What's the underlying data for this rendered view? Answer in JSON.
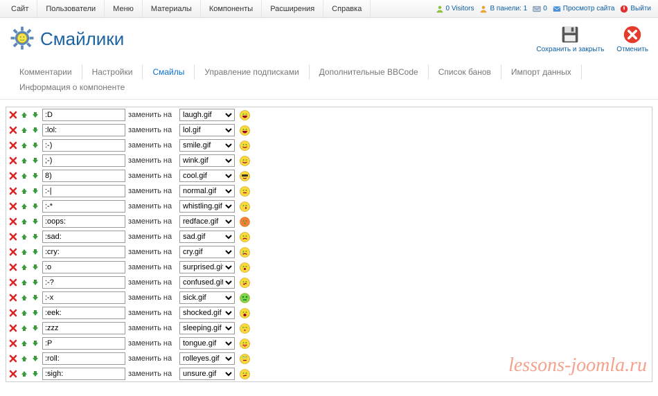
{
  "top_menu": {
    "items": [
      "Сайт",
      "Пользователи",
      "Меню",
      "Материалы",
      "Компоненты",
      "Расширения",
      "Справка"
    ]
  },
  "status_bar": {
    "visitors": {
      "label": "0 Visitors",
      "count": 0
    },
    "panel": {
      "label": "В панели: 1",
      "count": 1
    },
    "messages": {
      "label": "0",
      "count": 0
    },
    "preview": {
      "label": "Просмотр сайта"
    },
    "logout": {
      "label": "Выйти"
    }
  },
  "header": {
    "title": "Смайлики"
  },
  "toolbar": {
    "save_close": "Сохранить и закрыть",
    "cancel": "Отменить"
  },
  "tabs": {
    "items": [
      "Комментарии",
      "Настройки",
      "Смайлы",
      "Управление подписками",
      "Дополнительные BBCode",
      "Список банов",
      "Импорт данных",
      "Информация о компоненте"
    ],
    "active_index": 2
  },
  "rows_label": {
    "replace_with": "заменить на"
  },
  "smilies": [
    {
      "code": ":D",
      "file": "laugh.gif",
      "face": {
        "body": "#FFD93B",
        "mouth": "laugh"
      }
    },
    {
      "code": ":lol:",
      "file": "lol.gif",
      "face": {
        "body": "#FFD93B",
        "mouth": "laugh"
      }
    },
    {
      "code": ":-)",
      "file": "smile.gif",
      "face": {
        "body": "#FFD93B",
        "mouth": "smile"
      }
    },
    {
      "code": ";-)",
      "file": "wink.gif",
      "face": {
        "body": "#FFD93B",
        "mouth": "wink"
      }
    },
    {
      "code": "8)",
      "file": "cool.gif",
      "face": {
        "body": "#FFD93B",
        "mouth": "cool"
      }
    },
    {
      "code": ":-|",
      "file": "normal.gif",
      "face": {
        "body": "#FFD93B",
        "mouth": "flat"
      }
    },
    {
      "code": ":-*",
      "file": "whistling.gif",
      "face": {
        "body": "#FFD93B",
        "mouth": "whistle"
      }
    },
    {
      "code": ":oops:",
      "file": "redface.gif",
      "face": {
        "body": "#F97B3E",
        "mouth": "oops"
      }
    },
    {
      "code": ":sad:",
      "file": "sad.gif",
      "face": {
        "body": "#FFD93B",
        "mouth": "sad"
      }
    },
    {
      "code": ":cry:",
      "file": "cry.gif",
      "face": {
        "body": "#FFD93B",
        "mouth": "cry"
      }
    },
    {
      "code": ":o",
      "file": "surprised.gif",
      "face": {
        "body": "#FFD93B",
        "mouth": "o"
      }
    },
    {
      "code": ":-?",
      "file": "confused.gif",
      "face": {
        "body": "#FFD93B",
        "mouth": "confused"
      }
    },
    {
      "code": ":-x",
      "file": "sick.gif",
      "face": {
        "body": "#7BD84B",
        "mouth": "sick"
      }
    },
    {
      "code": ":eek:",
      "file": "shocked.gif",
      "face": {
        "body": "#FFD93B",
        "mouth": "eek"
      }
    },
    {
      "code": ":zzz",
      "file": "sleeping.gif",
      "face": {
        "body": "#FFD93B",
        "mouth": "zzz"
      }
    },
    {
      "code": ":P",
      "file": "tongue.gif",
      "face": {
        "body": "#FFD93B",
        "mouth": "tongue"
      }
    },
    {
      "code": ":roll:",
      "file": "rolleyes.gif",
      "face": {
        "body": "#FFD93B",
        "mouth": "roll"
      }
    },
    {
      "code": ":sigh:",
      "file": "unsure.gif",
      "face": {
        "body": "#FFD93B",
        "mouth": "unsure"
      }
    }
  ],
  "watermark": "lessons-joomla.ru"
}
